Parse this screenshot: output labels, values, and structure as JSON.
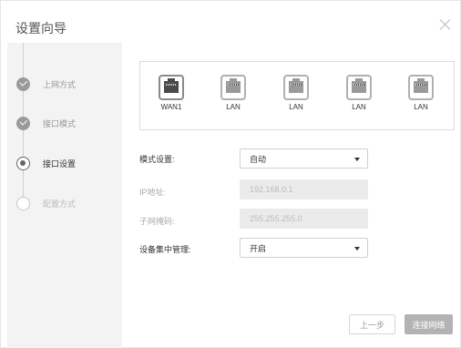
{
  "dialog": {
    "title": "设置向导"
  },
  "steps": [
    {
      "label": "上网方式",
      "state": "done"
    },
    {
      "label": "接口模式",
      "state": "done"
    },
    {
      "label": "接口设置",
      "state": "current"
    },
    {
      "label": "配置方式",
      "state": "pending"
    }
  ],
  "ports": [
    {
      "label": "WAN1",
      "icon": "ethernet-port-icon"
    },
    {
      "label": "LAN",
      "icon": "ethernet-port-icon"
    },
    {
      "label": "LAN",
      "icon": "ethernet-port-icon"
    },
    {
      "label": "LAN",
      "icon": "ethernet-port-icon"
    },
    {
      "label": "LAN",
      "icon": "ethernet-port-icon"
    }
  ],
  "form": {
    "mode": {
      "label": "模式设置:",
      "value": "自动"
    },
    "ip": {
      "label": "IP地址:",
      "value": "192.168.0.1"
    },
    "mask": {
      "label": "子网掩码:",
      "value": "255.255.255.0"
    },
    "central_mgmt": {
      "label": "设备集中管理:",
      "value": "开启"
    }
  },
  "buttons": {
    "prev": "上一步",
    "next": "连接网络"
  }
}
